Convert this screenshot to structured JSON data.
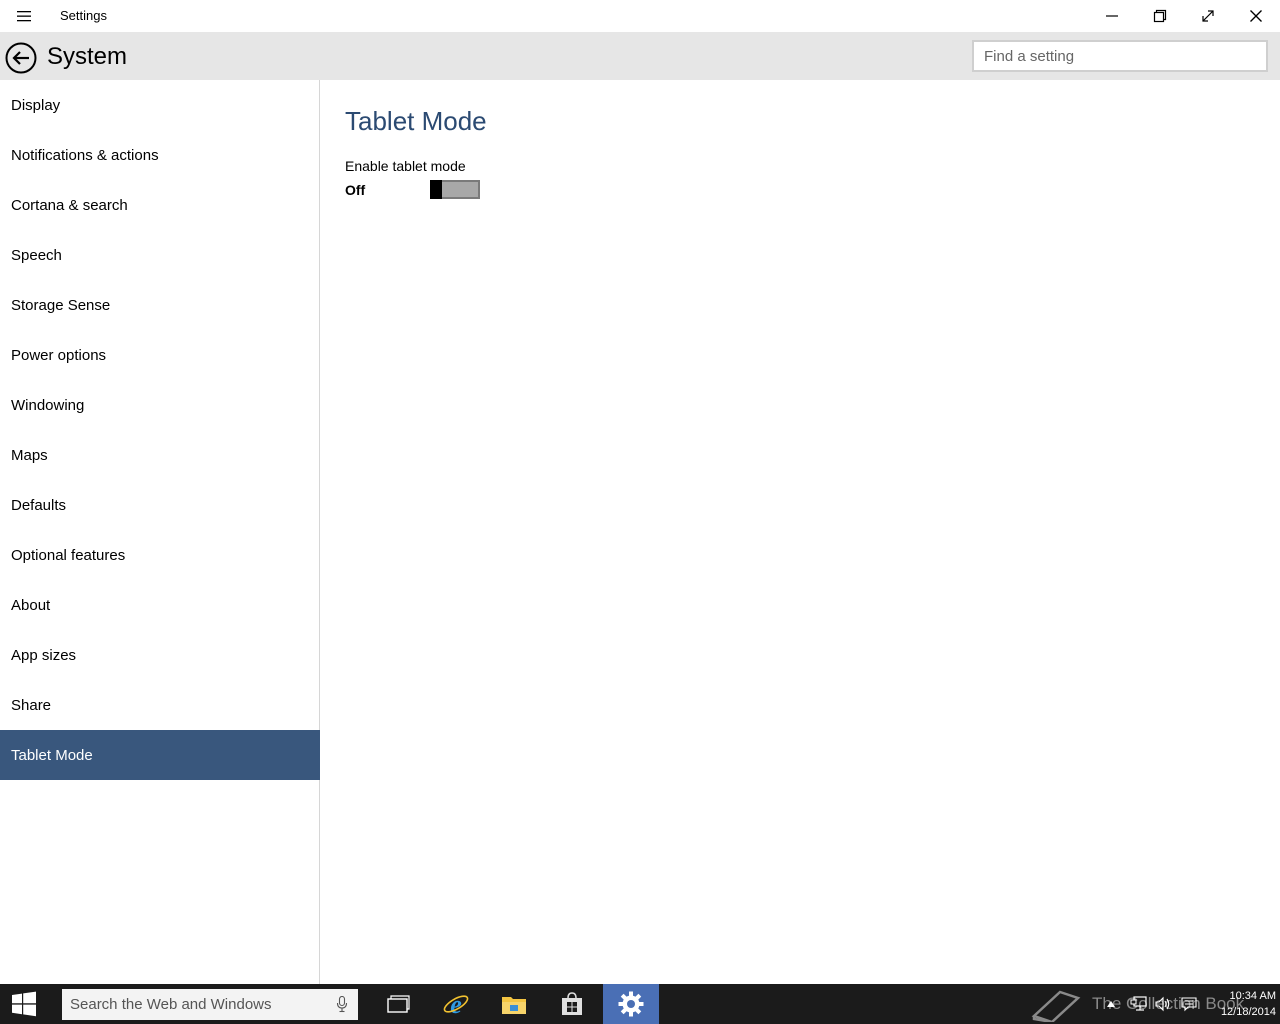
{
  "window": {
    "title": "Settings"
  },
  "header": {
    "title": "System",
    "search_placeholder": "Find a setting"
  },
  "sidebar": {
    "items": [
      {
        "label": "Display"
      },
      {
        "label": "Notifications & actions"
      },
      {
        "label": "Cortana & search"
      },
      {
        "label": "Speech"
      },
      {
        "label": "Storage Sense"
      },
      {
        "label": "Power options"
      },
      {
        "label": "Windowing"
      },
      {
        "label": "Maps"
      },
      {
        "label": "Defaults"
      },
      {
        "label": "Optional features"
      },
      {
        "label": "About"
      },
      {
        "label": "App sizes"
      },
      {
        "label": "Share"
      },
      {
        "label": "Tablet Mode",
        "selected": true
      }
    ]
  },
  "content": {
    "section_title": "Tablet Mode",
    "toggle": {
      "label": "Enable tablet mode",
      "state_text": "Off",
      "on": false
    }
  },
  "taskbar": {
    "search_placeholder": "Search the Web and Windows",
    "apps": [
      {
        "icon": "task-view-icon"
      },
      {
        "icon": "internet-explorer-icon"
      },
      {
        "icon": "file-explorer-icon"
      },
      {
        "icon": "store-icon"
      },
      {
        "icon": "settings-gear-icon",
        "active": true
      }
    ],
    "watermark": "The Collection Book",
    "clock": {
      "time": "10:34 AM",
      "date": "12/18/2014"
    }
  },
  "colors": {
    "selected_nav": "#39577d",
    "section_title": "#2b4a72",
    "header_bg": "#e6e6e6",
    "taskbar_bg": "#1b1b1b",
    "active_app": "#4a6fb5"
  }
}
